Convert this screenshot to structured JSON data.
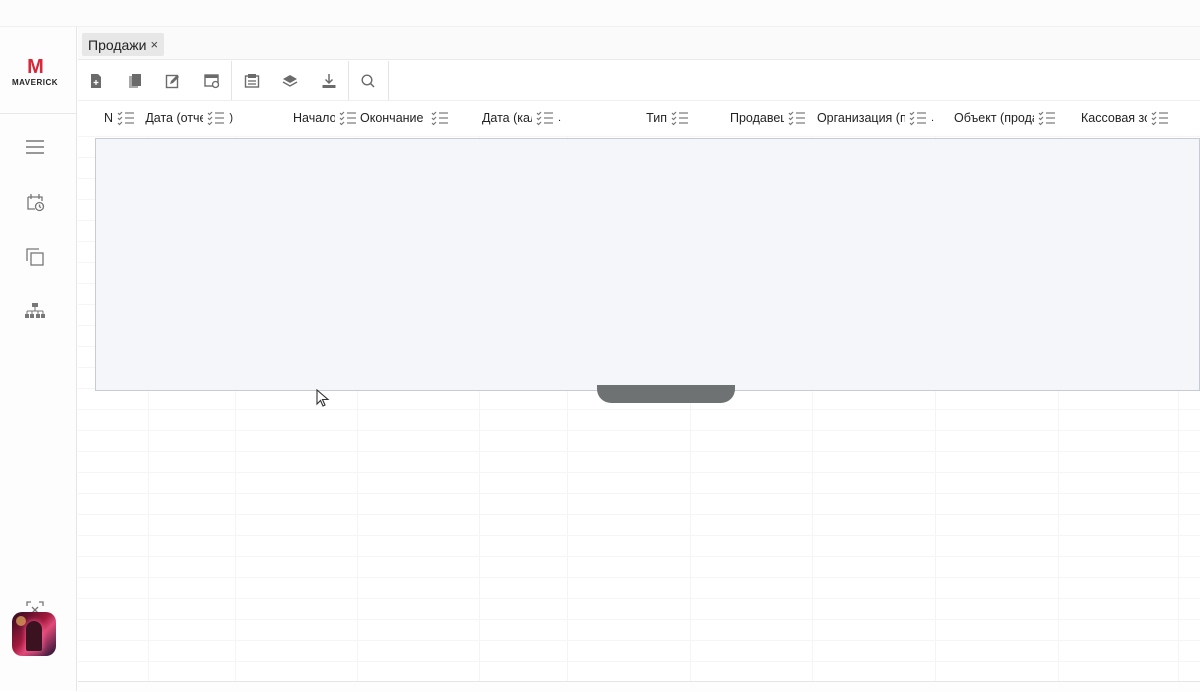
{
  "app": {
    "logo_letter": "M",
    "logo_text": "MAVERICK"
  },
  "sidebar": {
    "items": [
      {
        "name": "menu-icon"
      },
      {
        "name": "calendar-clock-icon"
      },
      {
        "name": "windows-icon"
      },
      {
        "name": "org-structure-icon"
      }
    ],
    "bottom": [
      {
        "name": "exit-fullscreen-icon"
      },
      {
        "name": "user-avatar"
      }
    ]
  },
  "tabs": [
    {
      "label": "Продажи",
      "close": "×",
      "active": true
    }
  ],
  "toolbar": {
    "groups": [
      [
        "new-document-icon",
        "copy-icon",
        "edit-icon",
        "settings-table-icon"
      ],
      [
        "report-icon",
        "layers-icon",
        "download-icon"
      ],
      [
        "search-icon"
      ]
    ]
  },
  "table": {
    "columns": [
      {
        "label": "N"
      },
      {
        "label": "Дата (отче",
        "suffix": ")"
      },
      {
        "label": "Начало"
      },
      {
        "label": "Окончание прод"
      },
      {
        "label": "Дата (кал",
        "suffix": "."
      },
      {
        "label": "Тип"
      },
      {
        "label": "Продавец"
      },
      {
        "label": "Организация (пр",
        "suffix": "."
      },
      {
        "label": "Объект (прода"
      },
      {
        "label": "Кассовая зон"
      }
    ],
    "rows": []
  },
  "colors": {
    "accent": "#d8283a",
    "brand_dark": "#1e2f4a",
    "overlay_bg": "#f4f6fa",
    "overlay_border": "#c7ccd4"
  }
}
